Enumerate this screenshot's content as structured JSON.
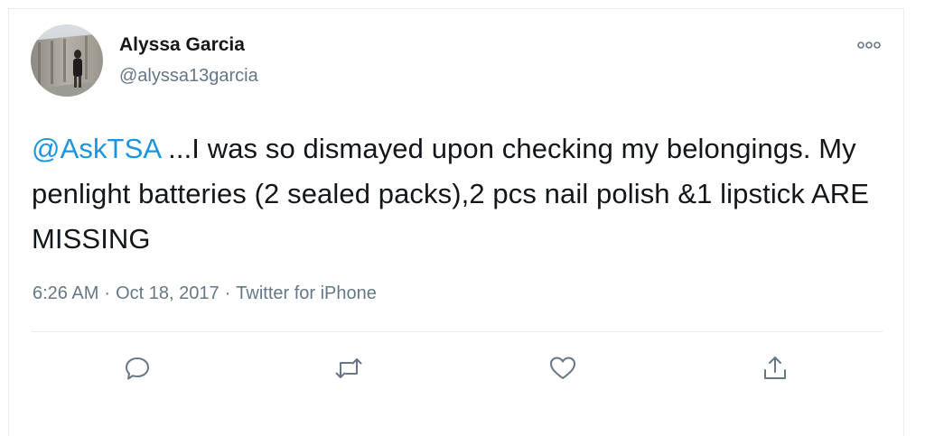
{
  "user": {
    "display_name": "Alyssa Garcia",
    "handle": "@alyssa13garcia"
  },
  "tweet": {
    "mention": "@AskTSA",
    "text": " ...I was so dismayed upon checking my belongings. My penlight batteries (2 sealed packs),2 pcs nail polish &1 lipstick ARE MISSING"
  },
  "meta": {
    "time": "6:26 AM",
    "separator": "·",
    "date": "Oct 18, 2017",
    "source": "Twitter for iPhone"
  },
  "actions": {
    "reply_icon": "reply-icon",
    "retweet_icon": "retweet-icon",
    "like_icon": "like-icon",
    "share_icon": "share-icon",
    "more_icon": "more-icon"
  },
  "colors": {
    "mention": "#1b95e0",
    "text": "#14171a",
    "muted": "#657786",
    "border": "#e6ecf0"
  }
}
